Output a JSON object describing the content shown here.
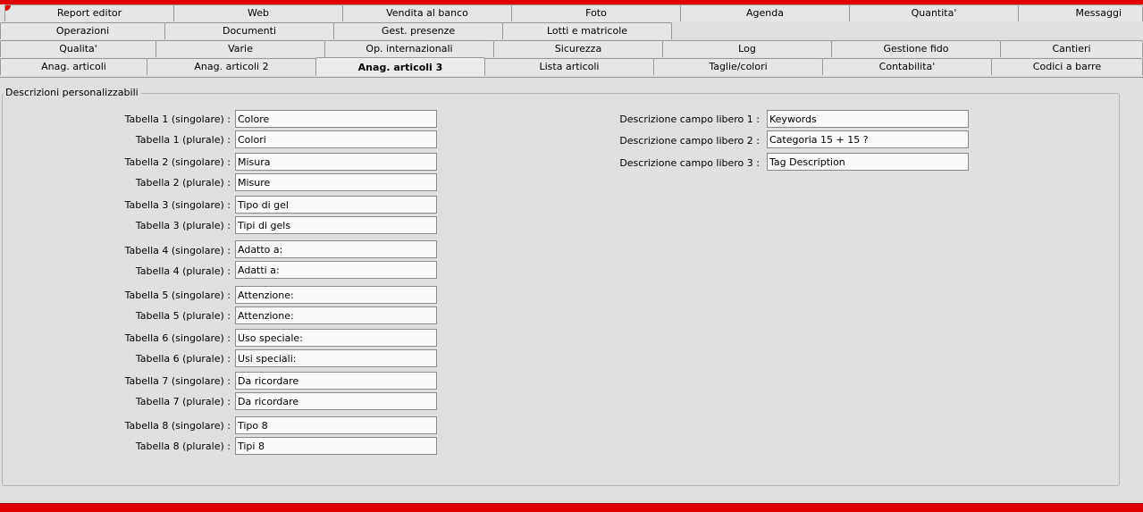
{
  "tabs": {
    "row1": [
      "Report editor",
      "Web",
      "Vendita al banco",
      "Foto",
      "Agenda",
      "Quantita'",
      "Messaggi"
    ],
    "row2": [
      "Operazioni",
      "Documenti",
      "Gest. presenze",
      "Lotti e matricole"
    ],
    "row3": [
      "Qualita'",
      "Varie",
      "Op. internazionali",
      "Sicurezza",
      "Log",
      "Gestione fido",
      "Cantieri"
    ],
    "row4": [
      "Anag. articoli",
      "Anag. articoli 2",
      "Anag. articoli 3",
      "Lista articoli",
      "Taglie/colori",
      "Contabilita'",
      "Codici a barre"
    ],
    "active": "Anag. articoli 3"
  },
  "group": {
    "title": "Descrizioni personalizzabili"
  },
  "tables": [
    {
      "label": "Tabella 1 (singolare) :",
      "value": "Colore"
    },
    {
      "label": "Tabella 1 (plurale) :",
      "value": "Colori"
    },
    {
      "label": "Tabella 2 (singolare) :",
      "value": "Misura"
    },
    {
      "label": "Tabella 2 (plurale) :",
      "value": "Misure"
    },
    {
      "label": "Tabella 3 (singolare) :",
      "value": "Tipo di gel"
    },
    {
      "label": "Tabella 3 (plurale) :",
      "value": "Tipi di gels"
    },
    {
      "label": "Tabella 4 (singolare) :",
      "value": "Adatto a:"
    },
    {
      "label": "Tabella 4 (plurale) :",
      "value": "Adatti a:"
    },
    {
      "label": "Tabella 5 (singolare) :",
      "value": "Attenzione:"
    },
    {
      "label": "Tabella 5 (plurale) :",
      "value": "Attenzione:"
    },
    {
      "label": "Tabella 6 (singolare) :",
      "value": "Uso speciale:"
    },
    {
      "label": "Tabella 6 (plurale) :",
      "value": "Usi speciali:"
    },
    {
      "label": "Tabella 7 (singolare) :",
      "value": "Da ricordare"
    },
    {
      "label": "Tabella 7 (plurale) :",
      "value": "Da ricordare"
    },
    {
      "label": "Tabella 8 (singolare) :",
      "value": "Tipo 8"
    },
    {
      "label": "Tabella 8 (plurale) :",
      "value": "Tipi 8"
    }
  ],
  "free_fields": [
    {
      "label": "Descrizione campo libero 1 :",
      "value": "Keywords"
    },
    {
      "label": "Descrizione campo libero 2 :",
      "value": "Categoria 15 + 15 ?"
    },
    {
      "label": "Descrizione campo libero 3 :",
      "value": "Tag Description"
    }
  ],
  "colors": {
    "accent_red": "#e00000",
    "background": "#e0e0e0"
  }
}
